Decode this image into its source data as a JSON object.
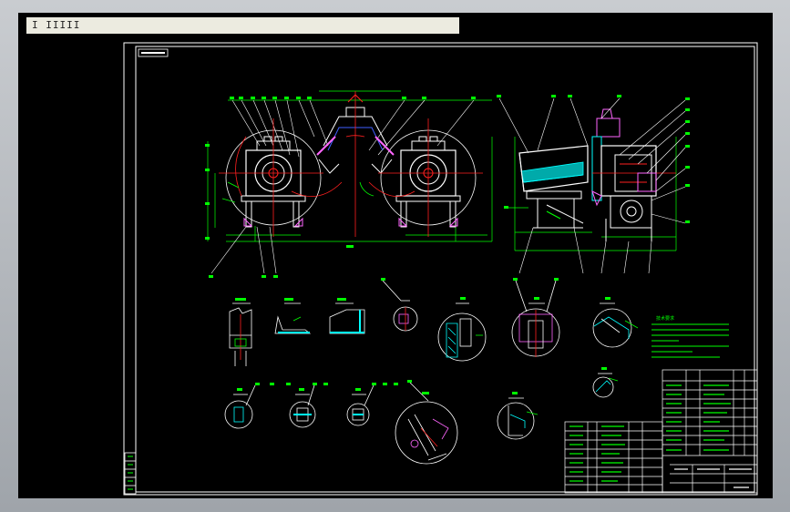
{
  "window": {
    "title": "I  IIIII"
  },
  "colors": {
    "background": "#000000",
    "frame": "#ffffff",
    "outline": "#ffffff",
    "dimension": "#00ff00",
    "centerline": "#ff2020",
    "section": "#00ffff",
    "detail": "#ff66ff",
    "text": "#ffff00",
    "blue": "#4060ff"
  },
  "drawing": {
    "notes_heading": "技术要求"
  }
}
